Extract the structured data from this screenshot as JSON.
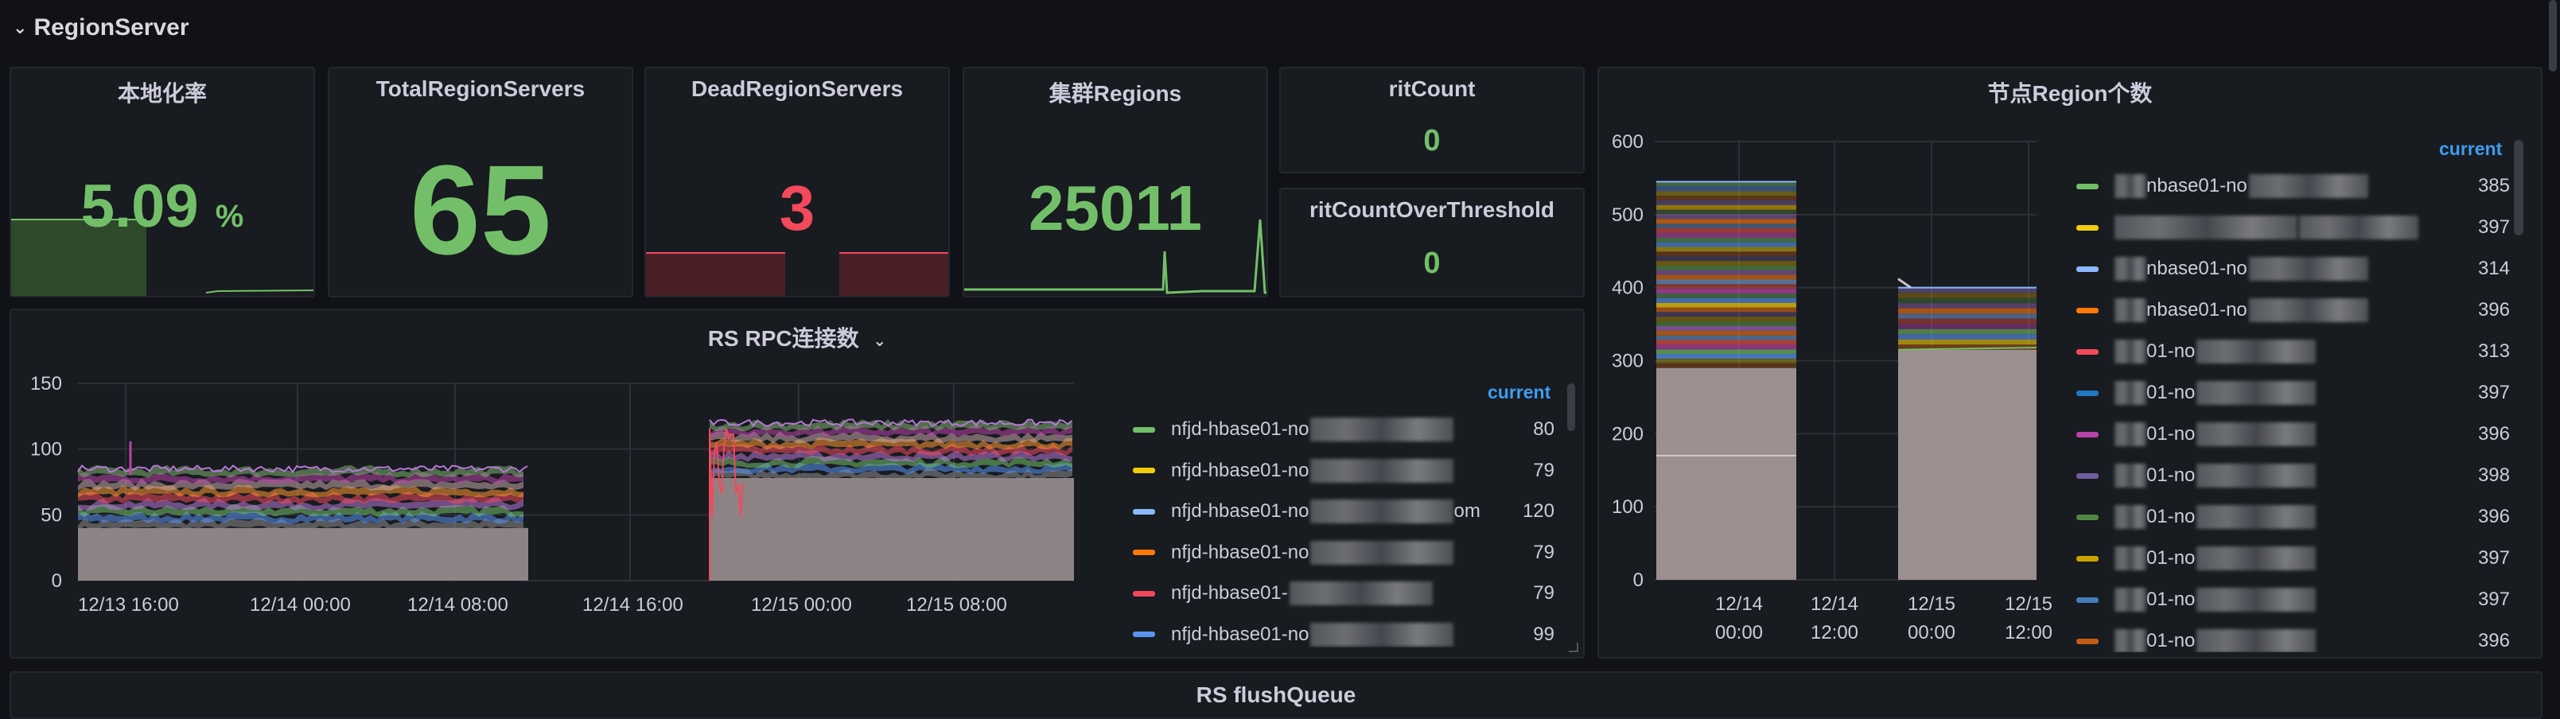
{
  "row": {
    "title": "RegionServer"
  },
  "stats": [
    {
      "title": "本地化率",
      "value": "5.09",
      "unit": "%"
    },
    {
      "title": "TotalRegionServers",
      "value": "65"
    },
    {
      "title": "DeadRegionServers",
      "value": "3"
    },
    {
      "title": "集群Regions",
      "value": "25011"
    },
    {
      "title": "ritCount",
      "value": "0"
    },
    {
      "title": "ritCountOverThreshold",
      "value": "0"
    }
  ],
  "colors": {
    "green": "#73bf69",
    "red": "#f2495c",
    "blue_header": "#3d9df3"
  },
  "rpc": {
    "title": "RS RPC连接数",
    "legend_header": "current",
    "legend": [
      {
        "name": "nfjd-hbase01-no",
        "value": "80",
        "color": "#73bf69"
      },
      {
        "name": "nfjd-hbase01-no",
        "value": "79",
        "color": "#f2cc0c"
      },
      {
        "name": "nfjd-hbase01-no",
        "suffix": "om",
        "value": "120",
        "color": "#8ab8ff"
      },
      {
        "name": "nfjd-hbase01-no",
        "value": "79",
        "color": "#ff780a"
      },
      {
        "name": "nfjd-hbase01-",
        "value": "79",
        "color": "#f2495c"
      },
      {
        "name": "nfjd-hbase01-no",
        "value": "99",
        "color": "#5794f2"
      }
    ]
  },
  "region": {
    "title": "节点Region个数",
    "legend_header": "current",
    "legend": [
      {
        "name": "nbase01-no",
        "value": "385",
        "color": "#73bf69"
      },
      {
        "name": "",
        "value": "397",
        "color": "#f2cc0c"
      },
      {
        "name": "nbase01-no",
        "value": "314",
        "color": "#8ab8ff"
      },
      {
        "name": "nbase01-no",
        "value": "396",
        "color": "#ff780a"
      },
      {
        "name": "01-no",
        "value": "313",
        "color": "#f2495c"
      },
      {
        "name": "01-no",
        "value": "397",
        "color": "#1f78c1"
      },
      {
        "name": "01-no",
        "value": "396",
        "color": "#ba43a9"
      },
      {
        "name": "01-no",
        "value": "398",
        "color": "#705da0"
      },
      {
        "name": "01-no",
        "value": "396",
        "color": "#508642"
      },
      {
        "name": "01-no",
        "value": "397",
        "color": "#cca300"
      },
      {
        "name": "01-no",
        "value": "397",
        "color": "#447ebc"
      },
      {
        "name": "01-no",
        "value": "396",
        "color": "#c15c17"
      }
    ]
  },
  "bottom_panel": {
    "title": "RS flushQueue"
  },
  "chart_data": [
    {
      "type": "area",
      "title": "RS RPC连接数",
      "ylim": [
        0,
        150
      ],
      "y_ticks": [
        "0",
        "50",
        "100",
        "150"
      ],
      "x_ticks": [
        "12/13 16:00",
        "12/14 00:00",
        "12/14 08:00",
        "12/14 16:00",
        "12/15 00:00",
        "12/15 08:00"
      ],
      "segments": [
        {
          "from": "12/13 16:00",
          "to": "12/14 11:00",
          "top": 85,
          "base_band": 40
        },
        {
          "from": "12/14 20:00",
          "to": "12/15 11:00",
          "top": 120,
          "base_band": 78
        }
      ]
    },
    {
      "type": "area",
      "title": "节点Region个数",
      "ylim": [
        0,
        600
      ],
      "y_ticks": [
        "0",
        "100",
        "200",
        "300",
        "400",
        "500",
        "600"
      ],
      "x_ticks": [
        "12/14\n00:00",
        "12/14\n12:00",
        "12/15\n00:00",
        "12/15\n12:00"
      ],
      "segments": [
        {
          "from": "12/13 16:00",
          "to": "12/14 08:00",
          "top": 545,
          "base_band": 290
        },
        {
          "from": "12/14 20:00",
          "to": "12/15 12:00",
          "top": 400,
          "base_band": 315
        }
      ]
    }
  ]
}
